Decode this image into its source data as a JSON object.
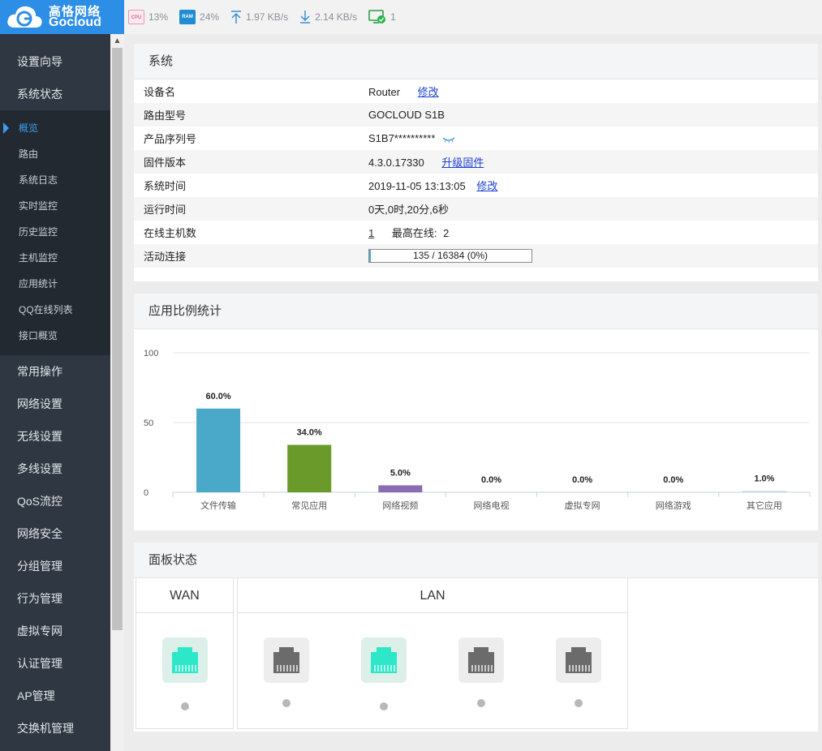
{
  "brand": {
    "name_cn": "高恪网络",
    "name_en": "Gocloud",
    "accent": "#2d8ee6"
  },
  "topbar": {
    "cpu_label": "CPU",
    "cpu": "13%",
    "ram_label": "RAM",
    "ram": "24%",
    "upload": "1.97 KB/s",
    "download": "2.14 KB/s",
    "online_devices": "1"
  },
  "sidebar": {
    "items_top": [
      {
        "label": "设置向导"
      },
      {
        "label": "系统状态"
      }
    ],
    "sub_items": [
      {
        "label": "概览",
        "active": true
      },
      {
        "label": "路由"
      },
      {
        "label": "系统日志"
      },
      {
        "label": "实时监控"
      },
      {
        "label": "历史监控"
      },
      {
        "label": "主机监控"
      },
      {
        "label": "应用统计"
      },
      {
        "label": "QQ在线列表"
      },
      {
        "label": "接口概览"
      }
    ],
    "items_bottom": [
      {
        "label": "常用操作"
      },
      {
        "label": "网络设置"
      },
      {
        "label": "无线设置"
      },
      {
        "label": "多线设置"
      },
      {
        "label": "QoS流控"
      },
      {
        "label": "网络安全"
      },
      {
        "label": "分组管理"
      },
      {
        "label": "行为管理"
      },
      {
        "label": "虚拟专网"
      },
      {
        "label": "认证管理"
      },
      {
        "label": "AP管理"
      },
      {
        "label": "交换机管理"
      }
    ]
  },
  "system": {
    "title": "系统",
    "rows": {
      "device_name": {
        "label": "设备名",
        "value": "Router",
        "action": "修改"
      },
      "model": {
        "label": "路由型号",
        "value": "GOCLOUD S1B"
      },
      "serial": {
        "label": "产品序列号",
        "value": "S1B7**********"
      },
      "firmware": {
        "label": "固件版本",
        "value": "4.3.0.17330",
        "action": "升级固件"
      },
      "time": {
        "label": "系统时间",
        "value": "2019-11-05 13:13:05",
        "action": "修改"
      },
      "uptime": {
        "label": "运行时间",
        "value": "0天,0时,20分,6秒"
      },
      "hosts": {
        "label": "在线主机数",
        "value": "1",
        "peak_label": "最高在线:",
        "peak": "2"
      },
      "connections": {
        "label": "活动连接",
        "value": "135 / 16384 (0%)",
        "fraction": 0.008
      }
    }
  },
  "app_stats": {
    "title": "应用比例统计"
  },
  "chart_data": {
    "type": "bar",
    "categories": [
      "文件传输",
      "常见应用",
      "网络视频",
      "网络电视",
      "虚拟专网",
      "网络游戏",
      "其它应用"
    ],
    "values": [
      60.0,
      34.0,
      5.0,
      0.0,
      0.0,
      0.0,
      1.0
    ],
    "labels": [
      "60.0%",
      "34.0%",
      "5.0%",
      "0.0%",
      "0.0%",
      "0.0%",
      "1.0%"
    ],
    "colors": [
      "#4aa8c8",
      "#6a9b2a",
      "#8a6db0",
      "#c9d8e3",
      "#c9d8e3",
      "#c9d8e3",
      "#c9d8e3"
    ],
    "ylim": [
      0,
      100
    ],
    "yticks": [
      0,
      50,
      100
    ],
    "grid": true
  },
  "panel_status": {
    "title": "面板状态",
    "wan_title": "WAN",
    "lan_title": "LAN",
    "ports_on_color": "#2de8c8",
    "ports_off_color": "#6b6b6b",
    "wan": [
      {
        "on": true
      }
    ],
    "lan": [
      {
        "on": false
      },
      {
        "on": true
      },
      {
        "on": false
      },
      {
        "on": false
      }
    ]
  }
}
